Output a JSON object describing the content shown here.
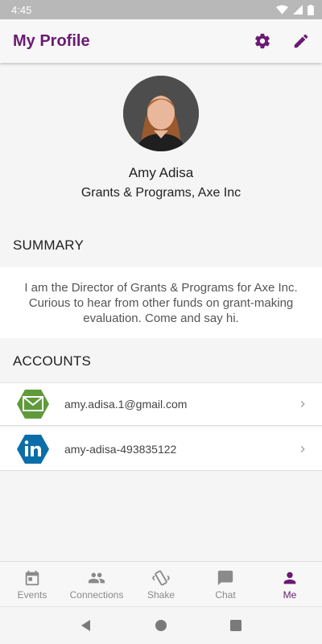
{
  "status_bar": {
    "time": "4:45"
  },
  "app_bar": {
    "title": "My Profile",
    "icons": [
      "gear-icon",
      "pencil-icon"
    ]
  },
  "profile": {
    "name": "Amy Adisa",
    "role": "Grants & Programs, Axe Inc"
  },
  "summary": {
    "heading": "SUMMARY",
    "text": "I am the Director of Grants & Programs for Axe Inc. Curious to hear from other funds on grant-making evaluation. Come and say hi."
  },
  "accounts": {
    "heading": "ACCOUNTS",
    "items": [
      {
        "icon": "email-icon",
        "label": "amy.adisa.1@gmail.com"
      },
      {
        "icon": "linkedin-icon",
        "label": "amy-adisa-493835122"
      }
    ]
  },
  "bottom_nav": {
    "items": [
      {
        "icon": "calendar-icon",
        "label": "Events"
      },
      {
        "icon": "people-icon",
        "label": "Connections"
      },
      {
        "icon": "shake-icon",
        "label": "Shake"
      },
      {
        "icon": "chat-icon",
        "label": "Chat"
      },
      {
        "icon": "person-icon",
        "label": "Me"
      }
    ],
    "active": "Me"
  },
  "colors": {
    "accent": "#6b1a73",
    "email_badge": "#5f9a3b",
    "linkedin_badge": "#0b6ea8",
    "inactive": "#8a8a8a"
  }
}
